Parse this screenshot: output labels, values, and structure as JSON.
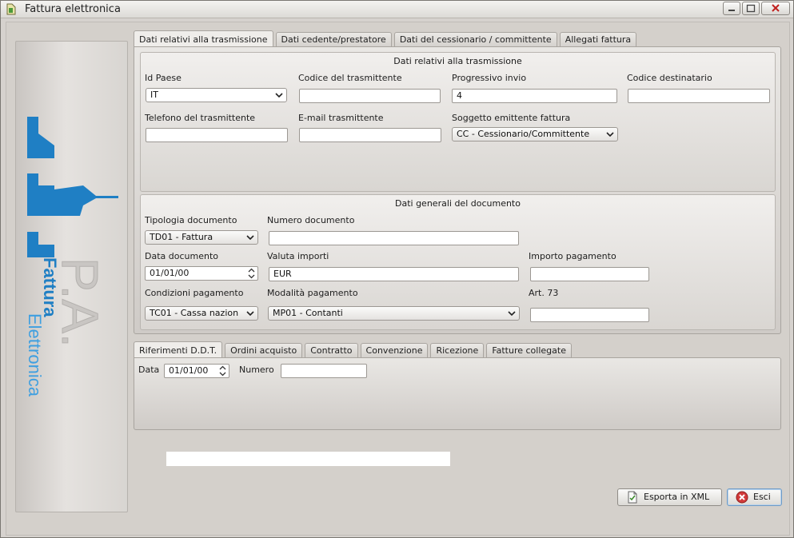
{
  "window": {
    "title": "Fattura elettronica"
  },
  "branding": {
    "line1": "P.A.",
    "line2": "Fattura",
    "line3": "Elettronica"
  },
  "main_tabs": [
    "Dati relativi alla trasmissione",
    "Dati cedente/prestatore",
    "Dati del cessionario / committente",
    "Allegati fattura"
  ],
  "trasmissione": {
    "group_title": "Dati relativi alla trasmissione",
    "id_paese_label": "Id Paese",
    "id_paese_value": "IT",
    "codice_trasmittente_label": "Codice del trasmittente",
    "codice_trasmittente_value": "",
    "progressivo_label": "Progressivo invio",
    "progressivo_value": "4",
    "codice_destinatario_label": "Codice destinatario",
    "codice_destinatario_value": "",
    "telefono_label": "Telefono del trasmittente",
    "telefono_value": "",
    "email_label": "E-mail trasmittente",
    "email_value": "",
    "soggetto_label": "Soggetto emittente fattura",
    "soggetto_value": "CC - Cessionario/Committente"
  },
  "documento": {
    "group_title": "Dati generali del documento",
    "tipologia_label": "Tipologia documento",
    "tipologia_value": "TD01 - Fattura",
    "numero_label": "Numero documento",
    "numero_value": "",
    "data_label": "Data documento",
    "data_value": "01/01/00",
    "valuta_label": "Valuta importi",
    "valuta_value": "EUR",
    "importo_label": "Importo pagamento",
    "importo_value": "",
    "condizioni_label": "Condizioni pagamento",
    "condizioni_value": "TC01 - Cassa nazion",
    "modalita_label": "Modalità pagamento",
    "modalita_value": "MP01 - Contanti",
    "art73_label": "Art. 73",
    "art73_value": ""
  },
  "sub_tabs": [
    "Riferimenti D.D.T.",
    "Ordini acquisto",
    "Contratto",
    "Convenzione",
    "Ricezione",
    "Fatture collegate"
  ],
  "ddt": {
    "data_label": "Data",
    "data_value": "01/01/00",
    "numero_label": "Numero",
    "numero_value": ""
  },
  "actions": {
    "export_label": "Esporta in XML",
    "exit_label": "Esci"
  },
  "colors": {
    "brand_blue": "#1f7fc4",
    "default_button_border": "#6f9bc6",
    "exit_icon": "#d23a3a"
  }
}
